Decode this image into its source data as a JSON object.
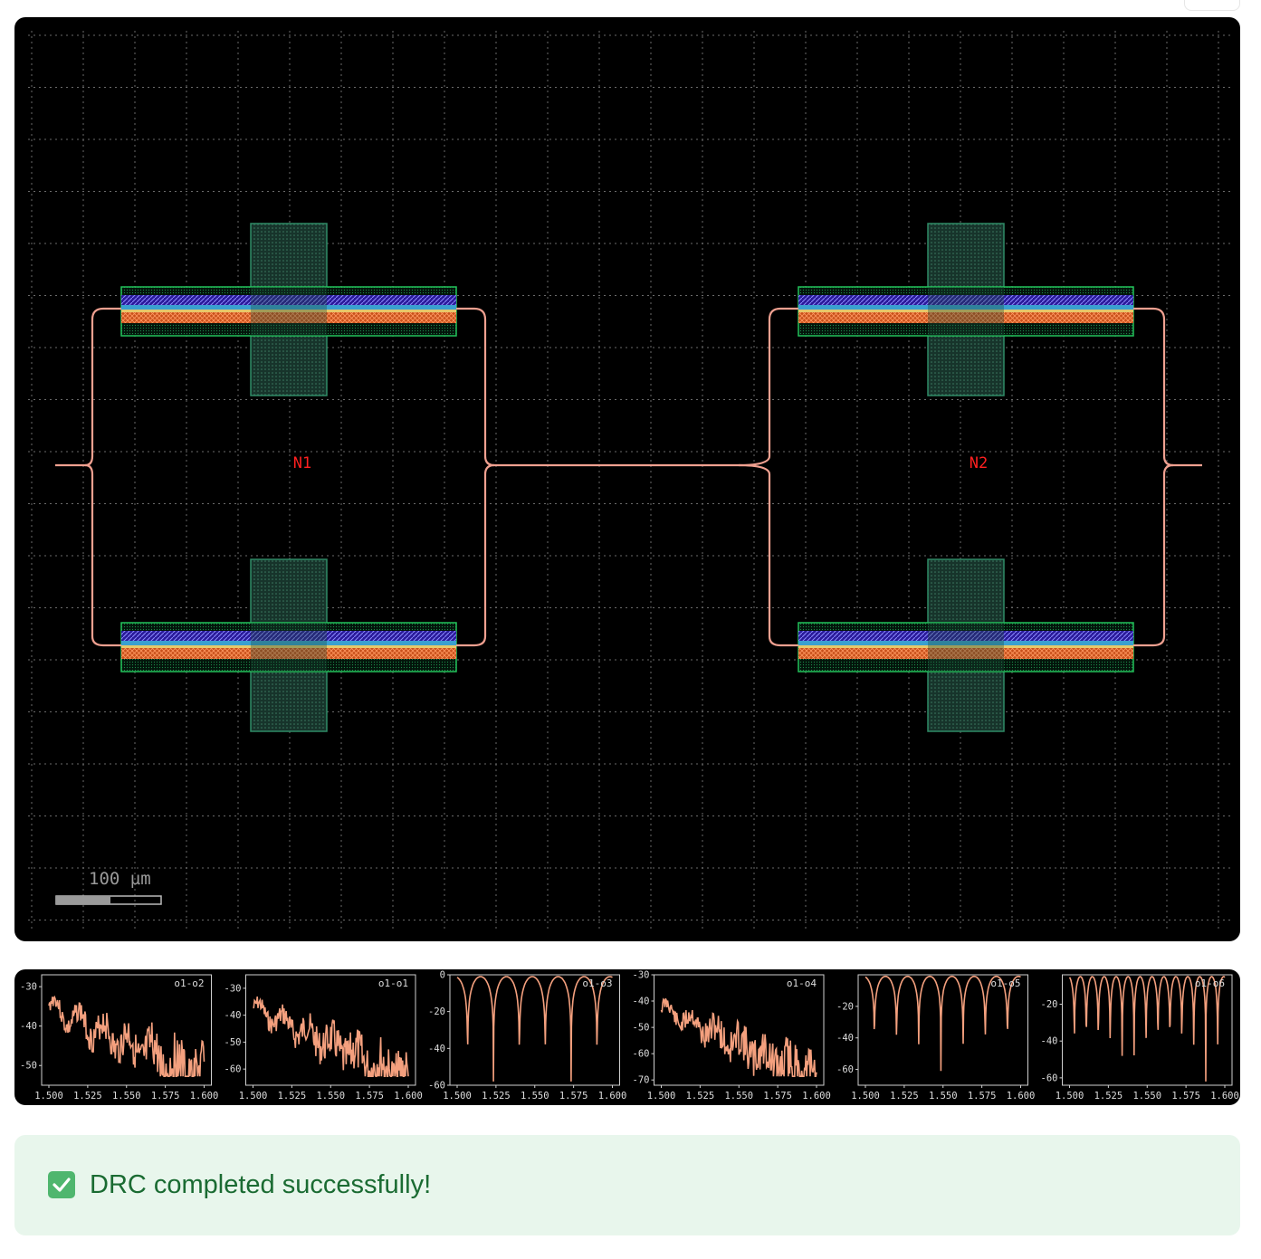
{
  "layout": {
    "labels": {
      "n1": "N1",
      "n2": "N2"
    },
    "scale_bar": "100 µm",
    "colors": {
      "waveguide": "#f0a090",
      "label": "#ff2020",
      "grid": "#6a6a6a"
    }
  },
  "plots": [
    {
      "name": "o1-o2",
      "xticks": [
        "1.500",
        "1.525",
        "1.550",
        "1.575",
        "1.600"
      ],
      "yticks": [
        "-30",
        "-40",
        "-50"
      ],
      "ylim": [
        -55,
        -27
      ],
      "kind": "noisy",
      "seed": 3
    },
    {
      "name": "o1-o1",
      "xticks": [
        "1.500",
        "1.525",
        "1.550",
        "1.575",
        "1.600"
      ],
      "yticks": [
        "-30",
        "-40",
        "-50",
        "-60"
      ],
      "ylim": [
        -66,
        -25
      ],
      "kind": "noisy",
      "seed": 7
    },
    {
      "name": "o1-o3",
      "xticks": [
        "1.500",
        "1.525",
        "1.550",
        "1.575",
        "1.600"
      ],
      "yticks": [
        "0",
        "-20",
        "-40",
        "-60"
      ],
      "ylim": [
        -60,
        0
      ],
      "kind": "fringe",
      "period": 6
    },
    {
      "name": "o1-o4",
      "xticks": [
        "1.500",
        "1.525",
        "1.550",
        "1.575",
        "1.600"
      ],
      "yticks": [
        "-30",
        "-40",
        "-50",
        "-60",
        "-70"
      ],
      "ylim": [
        -72,
        -30
      ],
      "kind": "noisy",
      "seed": 11
    },
    {
      "name": "o1-o5",
      "xticks": [
        "1.500",
        "1.525",
        "1.550",
        "1.575",
        "1.600"
      ],
      "yticks": [
        "-20",
        "-40",
        "-60"
      ],
      "ylim": [
        -70,
        0
      ],
      "kind": "fringe",
      "period": 7
    },
    {
      "name": "o1-o6",
      "xticks": [
        "1.500",
        "1.525",
        "1.550",
        "1.575",
        "1.600"
      ],
      "yticks": [
        "-20",
        "-40",
        "-60"
      ],
      "ylim": [
        -64,
        -4
      ],
      "kind": "fringe",
      "period": 13
    }
  ],
  "status": {
    "message": "DRC completed successfully!"
  }
}
